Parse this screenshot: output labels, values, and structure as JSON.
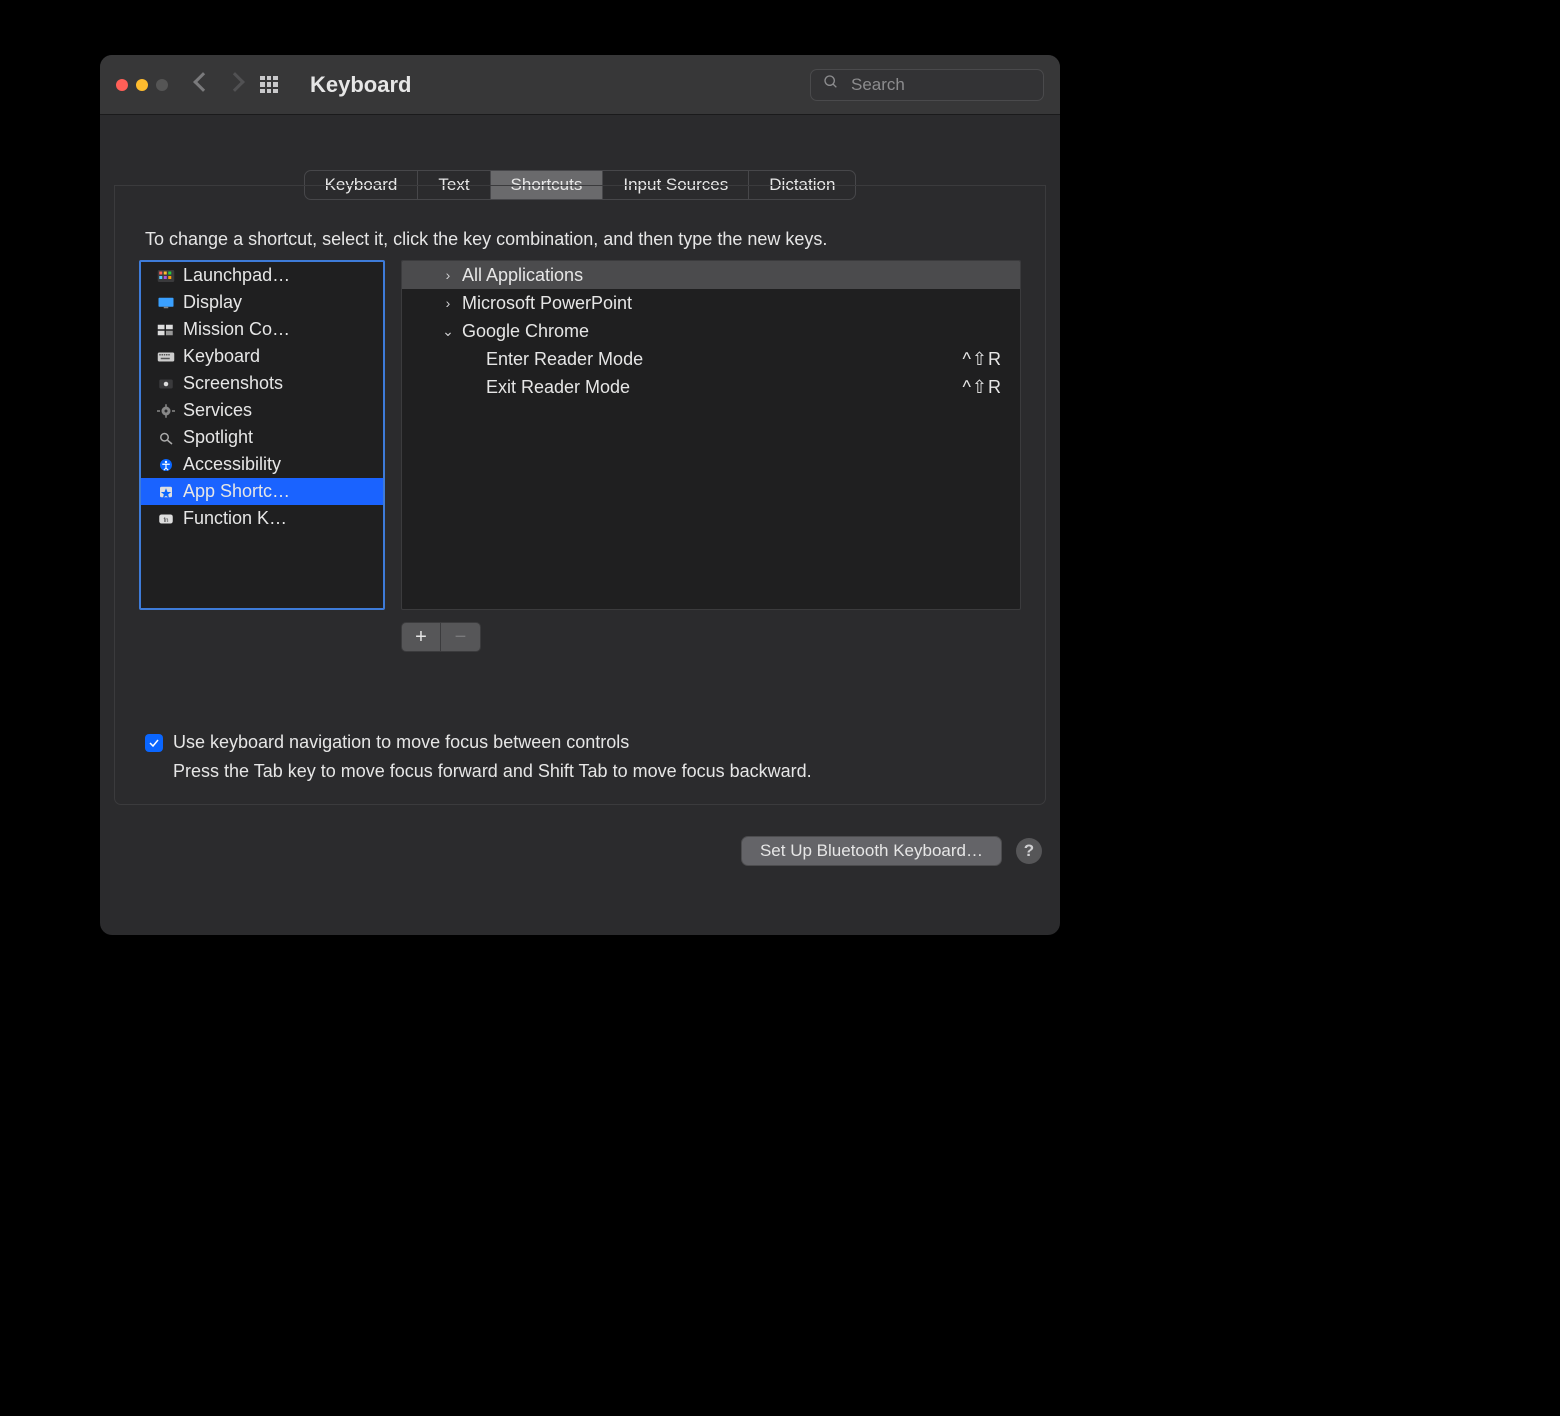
{
  "window": {
    "title": "Keyboard"
  },
  "search": {
    "placeholder": "Search",
    "value": ""
  },
  "tabs": [
    "Keyboard",
    "Text",
    "Shortcuts",
    "Input Sources",
    "Dictation"
  ],
  "tabs_selected_index": 2,
  "hint": "To change a shortcut, select it, click the key combination, and then type the new keys.",
  "categories": [
    {
      "label": "Launchpad…",
      "icon": "launchpad-icon"
    },
    {
      "label": "Display",
      "icon": "display-icon"
    },
    {
      "label": "Mission Co…",
      "icon": "mission-control-icon"
    },
    {
      "label": "Keyboard",
      "icon": "keyboard-icon"
    },
    {
      "label": "Screenshots",
      "icon": "screenshots-icon"
    },
    {
      "label": "Services",
      "icon": "services-icon"
    },
    {
      "label": "Spotlight",
      "icon": "spotlight-icon"
    },
    {
      "label": "Accessibility",
      "icon": "accessibility-icon"
    },
    {
      "label": "App Shortc…",
      "icon": "app-shortcuts-icon"
    },
    {
      "label": "Function K…",
      "icon": "function-keys-icon"
    }
  ],
  "categories_selected_index": 8,
  "shortcuts": {
    "rows": [
      {
        "kind": "group",
        "expanded": false,
        "label": "All Applications",
        "selected": true
      },
      {
        "kind": "group",
        "expanded": false,
        "label": "Microsoft PowerPoint",
        "selected": false
      },
      {
        "kind": "group",
        "expanded": true,
        "label": "Google Chrome",
        "selected": false
      },
      {
        "kind": "item",
        "label": "Enter Reader Mode",
        "combo": "^⇧R"
      },
      {
        "kind": "item",
        "label": "Exit Reader Mode",
        "combo": "^⇧R"
      }
    ]
  },
  "buttons": {
    "add": "+",
    "remove": "−",
    "bluetooth": "Set Up Bluetooth Keyboard…",
    "help": "?"
  },
  "checkbox": {
    "checked": true,
    "label": "Use keyboard navigation to move focus between controls",
    "sub": "Press the Tab key to move focus forward and Shift Tab to move focus backward."
  }
}
